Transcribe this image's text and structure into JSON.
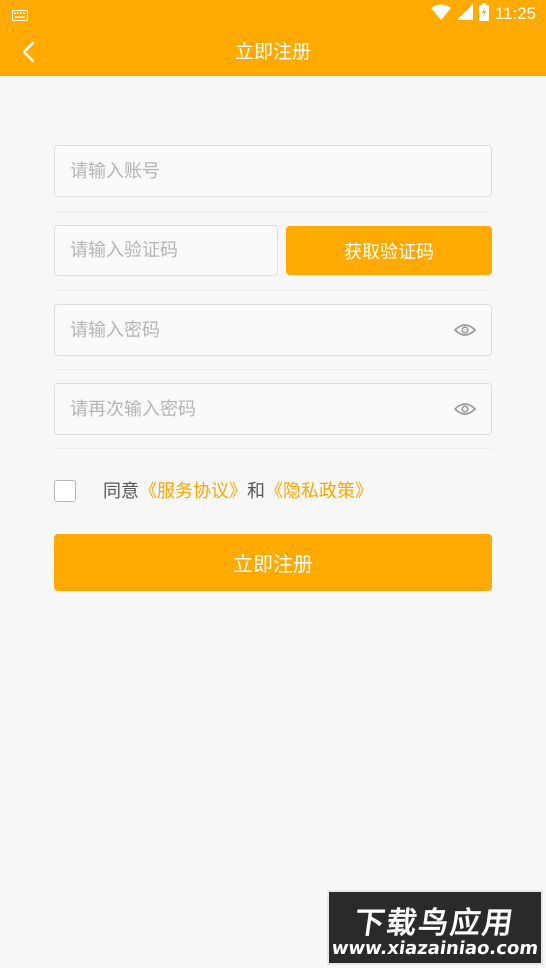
{
  "status_bar": {
    "time": "11:25",
    "left_icon": "keyboard-icon",
    "icons": [
      "wifi-icon",
      "signal-icon",
      "battery-icon"
    ]
  },
  "app_bar": {
    "title": "立即注册",
    "back_icon": "back-arrow-icon"
  },
  "form": {
    "account_placeholder": "请输入账号",
    "code_placeholder": "请输入验证码",
    "get_code_label": "获取验证码",
    "password_placeholder": "请输入密码",
    "confirm_password_placeholder": "请再次输入密码",
    "password_visibility_icon": "eye-icon"
  },
  "agreement": {
    "checked": false,
    "prefix": "同意",
    "service_link": "《服务协议》",
    "conjunction": "和",
    "privacy_link": "《隐私政策》"
  },
  "submit_label": "立即注册",
  "watermark": {
    "title": "下载鸟应用",
    "url": "www.xiazainiao.com"
  },
  "colors": {
    "accent": "#ffaa00",
    "background": "#f7f7f7",
    "link": "#ffa800"
  }
}
